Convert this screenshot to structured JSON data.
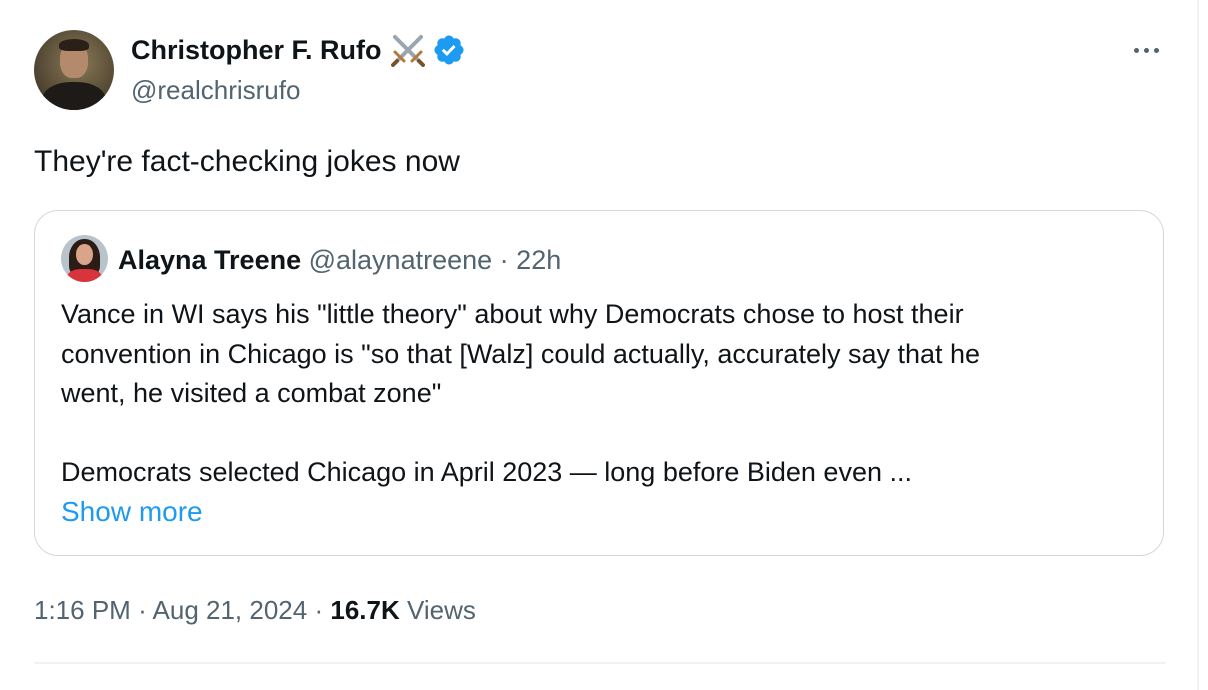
{
  "tweet": {
    "author_name": "Christopher F. Rufo",
    "author_handle": "@realchrisrufo",
    "name_icons": [
      "crossed-swords-icon",
      "verified-badge-icon"
    ],
    "text": "They're fact-checking jokes now",
    "time": "1:16 PM",
    "date": "Aug 21, 2024",
    "separator": "·",
    "views_count": "16.7K",
    "views_label": "Views",
    "more_icon": "more-options-icon"
  },
  "quote": {
    "author_name": "Alayna Treene",
    "author_handle": "@alaynatreene",
    "separator": "·",
    "age": "22h",
    "lines": [
      "Vance in WI says his \"little theory\" about why Democrats chose to host their",
      "convention in Chicago is \"so that [Walz] could actually, accurately say that he",
      "went, he visited a combat zone\""
    ],
    "line_after_gap": "Democrats selected Chicago in April 2023 — long before Biden even ...",
    "show_more": "Show more"
  },
  "colors": {
    "text_primary": "#0f1419",
    "text_secondary": "#536471",
    "link": "#1d9bf0",
    "verified": "#1d9bf0",
    "border": "#cfd9de",
    "divider": "#eff3f4"
  }
}
